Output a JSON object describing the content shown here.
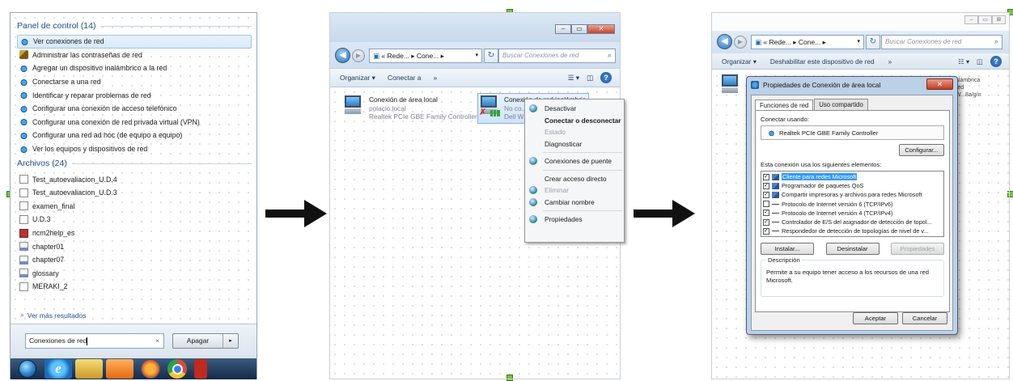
{
  "panel1": {
    "group1_title": "Panel de control (14)",
    "control_items": [
      {
        "label": "Ver conexiones de red",
        "icon": "network-icon",
        "selected": true
      },
      {
        "label": "Administrar las contraseñas de red",
        "icon": "key-icon"
      },
      {
        "label": "Agregar un dispositivo inalámbrico a la red",
        "icon": "network-icon"
      },
      {
        "label": "Conectarse a una red",
        "icon": "network-icon"
      },
      {
        "label": "Identificar y reparar problemas de red",
        "icon": "network-icon"
      },
      {
        "label": "Configurar una conexión de acceso telefónico",
        "icon": "network-icon"
      },
      {
        "label": "Configurar una conexión de red privada virtual (VPN)",
        "icon": "network-icon"
      },
      {
        "label": "Configurar una red ad hoc (de equipo a equipo)",
        "icon": "network-icon"
      },
      {
        "label": "Ver los equipos y dispositivos de red",
        "icon": "network-icon"
      }
    ],
    "group2_title": "Archivos (24)",
    "file_items": [
      {
        "label": "Test_autoevaliacion_U.D.4",
        "icon": "document-icon"
      },
      {
        "label": "Test_autoevaliacion_U.D.3",
        "icon": "document-icon"
      },
      {
        "label": "examen_final",
        "icon": "document-icon"
      },
      {
        "label": "U.D.3",
        "icon": "document-icon"
      },
      {
        "label": "ncm2help_es",
        "icon": "help-file-icon"
      },
      {
        "label": "chapter01",
        "icon": "visio-icon"
      },
      {
        "label": "chapter07",
        "icon": "visio-icon"
      },
      {
        "label": "glossary",
        "icon": "visio-icon"
      },
      {
        "label": "MERAKI_2",
        "icon": "document-icon"
      }
    ],
    "more_results": "Ver más resultados",
    "search_value": "Conexiones de red",
    "search_clear": "×",
    "shutdown_label": "Apagar",
    "shutdown_arrow": "▸"
  },
  "panel2": {
    "caption": {
      "minimize": "‒",
      "maximize": "▭",
      "close": "✕"
    },
    "back": "◀",
    "forward": "▶",
    "address": "« Rede... ▸ Cone... ▸",
    "address_dropdown": "▾",
    "refresh": "↻",
    "search_placeholder": "Buscar Conexiones de red",
    "search_icon": "⌕",
    "toolbar": {
      "organize": "Organizar ▾",
      "connect": "Conectar a",
      "more": "»",
      "views": "☰ ▾",
      "pane": "◫",
      "help": "?"
    },
    "conn1": {
      "name": "Conexión de área local",
      "sub1": "polacio.local",
      "sub2": "Realtek PCIe GBE Family Controller"
    },
    "conn2": {
      "name": "Conexión de red inalámbrica",
      "sub1": "No co...",
      "sub2": "Dell W..."
    },
    "context_menu": [
      {
        "label": "Desactivar",
        "icon": "shield-icon",
        "style": "normal"
      },
      {
        "label": "Conectar o desconectar",
        "style": "bold"
      },
      {
        "label": "Estado",
        "style": "disabled"
      },
      {
        "label": "Diagnosticar",
        "style": "normal"
      },
      {
        "sep": true
      },
      {
        "label": "Conexiones de puente",
        "icon": "shield-icon",
        "style": "normal"
      },
      {
        "sep": true
      },
      {
        "label": "Crear acceso directo",
        "style": "normal"
      },
      {
        "label": "Eliminar",
        "icon": "shield-icon",
        "style": "disabled"
      },
      {
        "label": "Cambiar nombre",
        "icon": "shield-icon",
        "style": "normal"
      },
      {
        "sep": true
      },
      {
        "label": "Propiedades",
        "icon": "shield-icon",
        "style": "normal"
      }
    ]
  },
  "panel3": {
    "caption": {
      "minimize": "‒",
      "maximize": "▭",
      "close": "⊠"
    },
    "address": "« Rede... ▸ Cone... ▸",
    "search_placeholder": "Buscar Conexiones de red",
    "toolbar": {
      "organize": "Organizar ▾",
      "disable": "Deshabilitar este dispositivo de red",
      "more": "»",
      "views": "☷ ▾",
      "pane": "◫",
      "help": "?"
    },
    "bg_text": "alámbrica\nred\nW...8a/g/n",
    "dialog": {
      "title": "Propiedades de Conexión de área local",
      "close": "✕",
      "tabs": [
        "Funciones de red",
        "Uso compartido"
      ],
      "connect_using_label": "Conectar usando:",
      "adapter": "Realtek PCIe GBE Family Controller",
      "configure": "Configurar...",
      "components_label": "Esta conexión usa los siguientes elementos:",
      "components": [
        {
          "checked": true,
          "icon": "client",
          "label": "Cliente para redes Microsoft",
          "selected": true
        },
        {
          "checked": true,
          "icon": "client",
          "label": "Programador de paquetes QoS"
        },
        {
          "checked": true,
          "icon": "client",
          "label": "Compartir impresoras y archivos para redes Microsoft"
        },
        {
          "checked": false,
          "icon": "protocol",
          "label": "Protocolo de Internet versión 6 (TCP/IPv6)"
        },
        {
          "checked": true,
          "icon": "protocol",
          "label": "Protocolo de Internet versión 4 (TCP/IPv4)"
        },
        {
          "checked": true,
          "icon": "protocol",
          "label": "Controlador de E/S del asignador de detección de topol..."
        },
        {
          "checked": true,
          "icon": "protocol",
          "label": "Respondedor de detección de topologías de nivel de v..."
        }
      ],
      "install": "Instalar...",
      "uninstall": "Desinstalar",
      "properties": "Propiedades",
      "description_label": "Descripción",
      "description": "Permite a su equipo tener acceso a los recursos de una red Microsoft.",
      "ok": "Aceptar",
      "cancel": "Cancelar"
    }
  },
  "colors": {
    "arrow": "#111111",
    "handle": "#7ac143",
    "selection": "#3399ff",
    "link": "#1e4e8c"
  }
}
